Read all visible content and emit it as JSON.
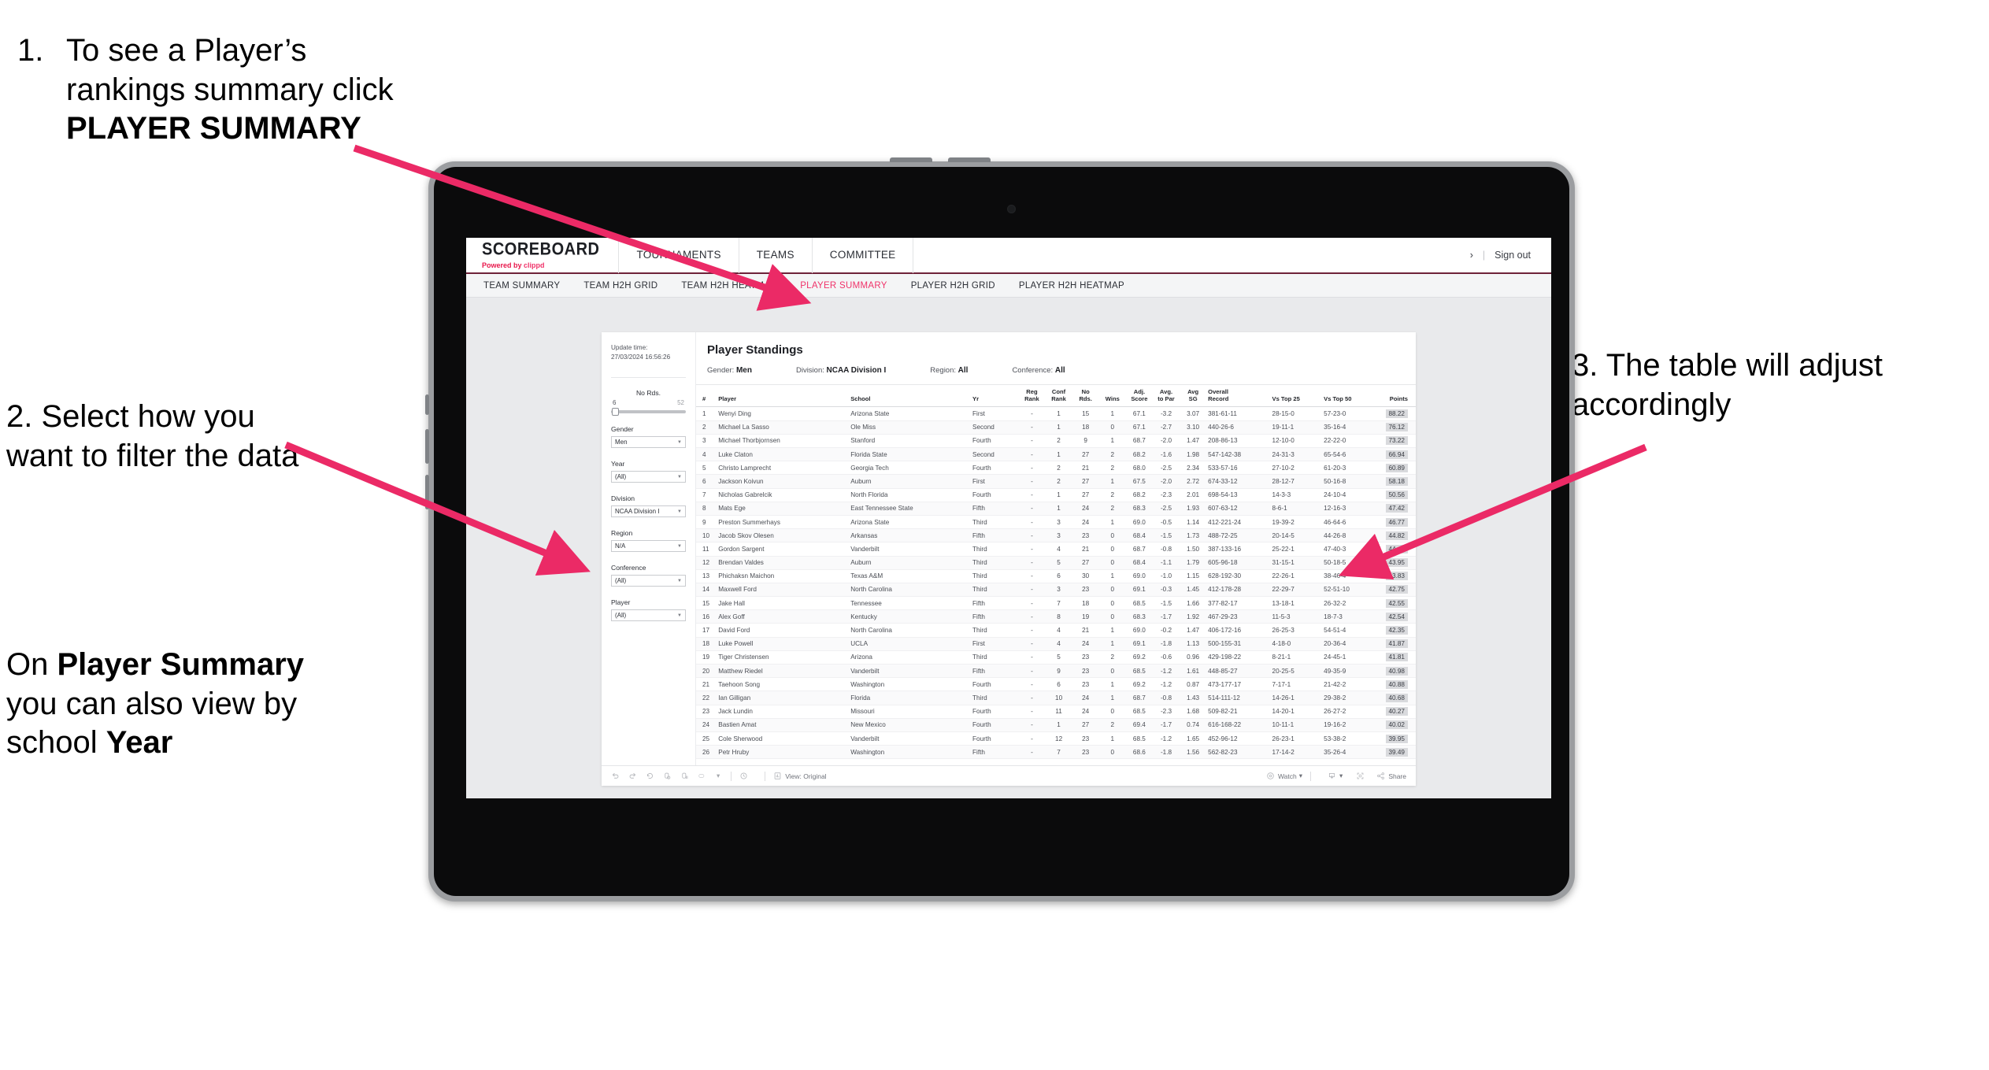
{
  "annotations": {
    "a1_number": "1.",
    "a1_text_plain_1": "To see a Player’s rankings summary click ",
    "a1_text_bold": "PLAYER SUMMARY",
    "a2": "2. Select how you want to filter the data",
    "a3": "3. The table will adjust accordingly",
    "a4_p1": "On ",
    "a4_b1": "Player Summary",
    "a4_p2": " you can also view by school ",
    "a4_b2": "Year"
  },
  "app": {
    "logo_title": "SCOREBOARD",
    "logo_sub_prefix": "Powered by ",
    "logo_sub_brand": "clippd",
    "nav": [
      {
        "label": "TOURNAMENTS"
      },
      {
        "label": "TEAMS"
      },
      {
        "label": "COMMITTEE"
      }
    ],
    "chevron": "›",
    "separator": "|",
    "sign_out": "Sign out",
    "subnav": [
      {
        "label": "TEAM SUMMARY",
        "active": false
      },
      {
        "label": "TEAM H2H GRID",
        "active": false
      },
      {
        "label": "TEAM H2H HEATMAP",
        "active": false
      },
      {
        "label": "PLAYER SUMMARY",
        "active": true
      },
      {
        "label": "PLAYER H2H GRID",
        "active": false
      },
      {
        "label": "PLAYER H2H HEATMAP",
        "active": false
      }
    ],
    "accent_color": "#f0336a",
    "brand_underline": "#6e2239"
  },
  "filters": {
    "update_label": "Update time:",
    "update_value": "27/03/2024 16:56:26",
    "slider": {
      "label": "No Rds.",
      "min": "6",
      "max": "52"
    },
    "selects": [
      {
        "label": "Gender",
        "value": "Men"
      },
      {
        "label": "Year",
        "value": "(All)"
      },
      {
        "label": "Division",
        "value": "NCAA Division I"
      },
      {
        "label": "Region",
        "value": "N/A"
      },
      {
        "label": "Conference",
        "value": "(All)"
      },
      {
        "label": "Player",
        "value": "(All)"
      }
    ]
  },
  "viz": {
    "title": "Player Standings",
    "meta": [
      {
        "label": "Gender:",
        "value": "Men"
      },
      {
        "label": "Division:",
        "value": "NCAA Division I"
      },
      {
        "label": "Region:",
        "value": "All"
      },
      {
        "label": "Conference:",
        "value": "All"
      }
    ],
    "columns": [
      {
        "key": "num",
        "l1": "#",
        "l2": "",
        "cls": "c-num"
      },
      {
        "key": "player",
        "l1": "Player",
        "l2": "",
        "cls": "c-player"
      },
      {
        "key": "school",
        "l1": "School",
        "l2": "",
        "cls": "c-school"
      },
      {
        "key": "yr",
        "l1": "Yr",
        "l2": "",
        "cls": "c-yr"
      },
      {
        "key": "regrank",
        "l1": "Reg",
        "l2": "Rank",
        "cls": "c-s"
      },
      {
        "key": "confrank",
        "l1": "Conf",
        "l2": "Rank",
        "cls": "c-s"
      },
      {
        "key": "nords",
        "l1": "No",
        "l2": "Rds.",
        "cls": "c-s"
      },
      {
        "key": "wins",
        "l1": "Wins",
        "l2": "",
        "cls": "c-s"
      },
      {
        "key": "adjscore",
        "l1": "Adj.",
        "l2": "Score",
        "cls": "c-s"
      },
      {
        "key": "avgpar",
        "l1": "Avg.",
        "l2": "to Par",
        "cls": "c-s"
      },
      {
        "key": "avgsg",
        "l1": "Avg",
        "l2": "SG",
        "cls": "c-s"
      },
      {
        "key": "record",
        "l1": "Overall",
        "l2": "Record",
        "cls": "c-rec"
      },
      {
        "key": "top25",
        "l1": "Vs Top 25",
        "l2": "",
        "cls": "c-t"
      },
      {
        "key": "top50",
        "l1": "Vs Top 50",
        "l2": "",
        "cls": "c-t"
      },
      {
        "key": "points",
        "l1": "Points",
        "l2": "",
        "cls": "c-pts"
      }
    ],
    "rows": [
      [
        "1",
        "Wenyi Ding",
        "Arizona State",
        "First",
        "-",
        "1",
        "15",
        "1",
        "67.1",
        "-3.2",
        "3.07",
        "381-61-11",
        "28-15-0",
        "57-23-0",
        "88.22"
      ],
      [
        "2",
        "Michael La Sasso",
        "Ole Miss",
        "Second",
        "-",
        "1",
        "18",
        "0",
        "67.1",
        "-2.7",
        "3.10",
        "440-26-6",
        "19-11-1",
        "35-16-4",
        "76.12"
      ],
      [
        "3",
        "Michael Thorbjornsen",
        "Stanford",
        "Fourth",
        "-",
        "2",
        "9",
        "1",
        "68.7",
        "-2.0",
        "1.47",
        "208-86-13",
        "12-10-0",
        "22-22-0",
        "73.22"
      ],
      [
        "4",
        "Luke Claton",
        "Florida State",
        "Second",
        "-",
        "1",
        "27",
        "2",
        "68.2",
        "-1.6",
        "1.98",
        "547-142-38",
        "24-31-3",
        "65-54-6",
        "66.94"
      ],
      [
        "5",
        "Christo Lamprecht",
        "Georgia Tech",
        "Fourth",
        "-",
        "2",
        "21",
        "2",
        "68.0",
        "-2.5",
        "2.34",
        "533-57-16",
        "27-10-2",
        "61-20-3",
        "60.89"
      ],
      [
        "6",
        "Jackson Koivun",
        "Auburn",
        "First",
        "-",
        "2",
        "27",
        "1",
        "67.5",
        "-2.0",
        "2.72",
        "674-33-12",
        "28-12-7",
        "50-16-8",
        "58.18"
      ],
      [
        "7",
        "Nicholas Gabrelcik",
        "North Florida",
        "Fourth",
        "-",
        "1",
        "27",
        "2",
        "68.2",
        "-2.3",
        "2.01",
        "698-54-13",
        "14-3-3",
        "24-10-4",
        "50.56"
      ],
      [
        "8",
        "Mats Ege",
        "East Tennessee State",
        "Fifth",
        "-",
        "1",
        "24",
        "2",
        "68.3",
        "-2.5",
        "1.93",
        "607-63-12",
        "8-6-1",
        "12-16-3",
        "47.42"
      ],
      [
        "9",
        "Preston Summerhays",
        "Arizona State",
        "Third",
        "-",
        "3",
        "24",
        "1",
        "69.0",
        "-0.5",
        "1.14",
        "412-221-24",
        "19-39-2",
        "46-64-6",
        "46.77"
      ],
      [
        "10",
        "Jacob Skov Olesen",
        "Arkansas",
        "Fifth",
        "-",
        "3",
        "23",
        "0",
        "68.4",
        "-1.5",
        "1.73",
        "488-72-25",
        "20-14-5",
        "44-26-8",
        "44.82"
      ],
      [
        "11",
        "Gordon Sargent",
        "Vanderbilt",
        "Third",
        "-",
        "4",
        "21",
        "0",
        "68.7",
        "-0.8",
        "1.50",
        "387-133-16",
        "25-22-1",
        "47-40-3",
        "44.49"
      ],
      [
        "12",
        "Brendan Valdes",
        "Auburn",
        "Third",
        "-",
        "5",
        "27",
        "0",
        "68.4",
        "-1.1",
        "1.79",
        "605-96-18",
        "31-15-1",
        "50-18-5",
        "43.95"
      ],
      [
        "13",
        "Phichaksn Maichon",
        "Texas A&M",
        "Third",
        "-",
        "6",
        "30",
        "1",
        "69.0",
        "-1.0",
        "1.15",
        "628-192-30",
        "22-26-1",
        "38-46-4",
        "43.83"
      ],
      [
        "14",
        "Maxwell Ford",
        "North Carolina",
        "Third",
        "-",
        "3",
        "23",
        "0",
        "69.1",
        "-0.3",
        "1.45",
        "412-178-28",
        "22-29-7",
        "52-51-10",
        "42.75"
      ],
      [
        "15",
        "Jake Hall",
        "Tennessee",
        "Fifth",
        "-",
        "7",
        "18",
        "0",
        "68.5",
        "-1.5",
        "1.66",
        "377-82-17",
        "13-18-1",
        "26-32-2",
        "42.55"
      ],
      [
        "16",
        "Alex Goff",
        "Kentucky",
        "Fifth",
        "-",
        "8",
        "19",
        "0",
        "68.3",
        "-1.7",
        "1.92",
        "467-29-23",
        "11-5-3",
        "18-7-3",
        "42.54"
      ],
      [
        "17",
        "David Ford",
        "North Carolina",
        "Third",
        "-",
        "4",
        "21",
        "1",
        "69.0",
        "-0.2",
        "1.47",
        "406-172-16",
        "26-25-3",
        "54-51-4",
        "42.35"
      ],
      [
        "18",
        "Luke Powell",
        "UCLA",
        "First",
        "-",
        "4",
        "24",
        "1",
        "69.1",
        "-1.8",
        "1.13",
        "500-155-31",
        "4-18-0",
        "20-36-4",
        "41.87"
      ],
      [
        "19",
        "Tiger Christensen",
        "Arizona",
        "Third",
        "-",
        "5",
        "23",
        "2",
        "69.2",
        "-0.6",
        "0.96",
        "429-198-22",
        "8-21-1",
        "24-45-1",
        "41.81"
      ],
      [
        "20",
        "Matthew Riedel",
        "Vanderbilt",
        "Fifth",
        "-",
        "9",
        "23",
        "0",
        "68.5",
        "-1.2",
        "1.61",
        "448-85-27",
        "20-25-5",
        "49-35-9",
        "40.98"
      ],
      [
        "21",
        "Taehoon Song",
        "Washington",
        "Fourth",
        "-",
        "6",
        "23",
        "1",
        "69.2",
        "-1.2",
        "0.87",
        "473-177-17",
        "7-17-1",
        "21-42-2",
        "40.88"
      ],
      [
        "22",
        "Ian Gilligan",
        "Florida",
        "Third",
        "-",
        "10",
        "24",
        "1",
        "68.7",
        "-0.8",
        "1.43",
        "514-111-12",
        "14-26-1",
        "29-38-2",
        "40.68"
      ],
      [
        "23",
        "Jack Lundin",
        "Missouri",
        "Fourth",
        "-",
        "11",
        "24",
        "0",
        "68.5",
        "-2.3",
        "1.68",
        "509-82-21",
        "14-20-1",
        "26-27-2",
        "40.27"
      ],
      [
        "24",
        "Bastien Amat",
        "New Mexico",
        "Fourth",
        "-",
        "1",
        "27",
        "2",
        "69.4",
        "-1.7",
        "0.74",
        "616-168-22",
        "10-11-1",
        "19-16-2",
        "40.02"
      ],
      [
        "25",
        "Cole Sherwood",
        "Vanderbilt",
        "Fourth",
        "-",
        "12",
        "23",
        "1",
        "68.5",
        "-1.2",
        "1.65",
        "452-96-12",
        "26-23-1",
        "53-38-2",
        "39.95"
      ],
      [
        "26",
        "Petr Hruby",
        "Washington",
        "Fifth",
        "-",
        "7",
        "23",
        "0",
        "68.6",
        "-1.8",
        "1.56",
        "562-82-23",
        "17-14-2",
        "35-26-4",
        "39.49"
      ]
    ],
    "footer": {
      "view_label": "View: Original",
      "watch_label": "Watch",
      "share_label": "Share",
      "caret": "▾"
    }
  }
}
